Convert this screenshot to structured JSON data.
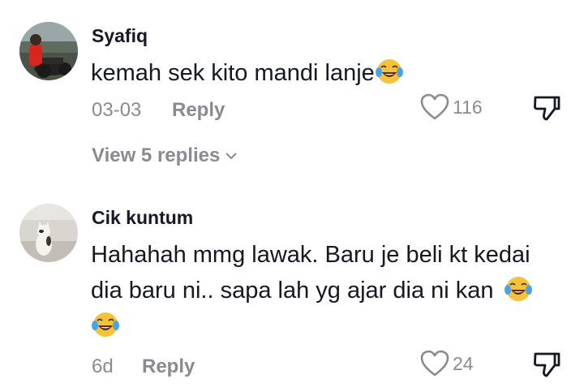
{
  "comments": [
    {
      "username": "Syafiq",
      "text": "kemah sek kito mandi lanje",
      "trailing_emoji": "face-with-tears-of-joy",
      "date": "03-03",
      "reply_label": "Reply",
      "likes": "116",
      "view_replies": "View 5 replies"
    },
    {
      "username": "Cik kuntum",
      "text_line1": "Hahahah mmg lawak. Baru je beli kt kedai",
      "text_line2": "dia baru ni.. sapa lah yg ajar dia ni kan",
      "trailing_emoji": "face-with-tears-of-joy",
      "date": "6d",
      "reply_label": "Reply",
      "likes": "24"
    }
  ],
  "colors": {
    "primary_text": "#161823",
    "secondary_text": "#8a8b91",
    "background": "#ffffff"
  },
  "icons": {
    "like": "heart-outline-icon",
    "dislike": "thumbs-down-icon",
    "expand": "chevron-down-icon",
    "emoji": "face-with-tears-of-joy-icon"
  }
}
